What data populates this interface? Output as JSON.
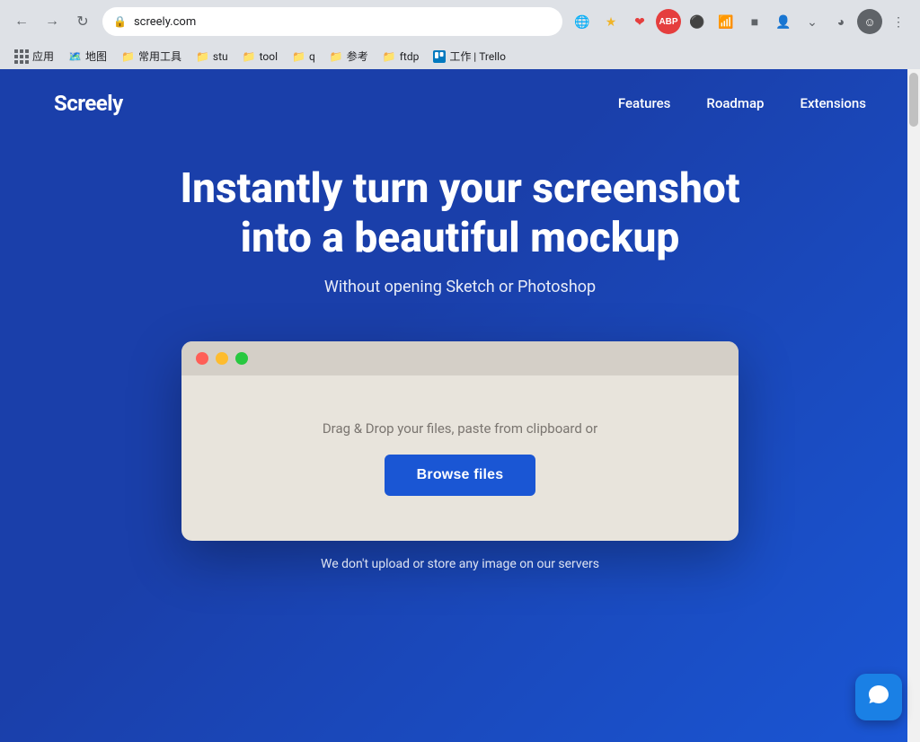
{
  "browser": {
    "url": "screely.com",
    "back_icon": "←",
    "forward_icon": "→",
    "refresh_icon": "↻",
    "lock_icon": "🔒",
    "bookmarks": [
      {
        "label": "应用",
        "icon": "grid"
      },
      {
        "label": "地图",
        "icon": "map"
      },
      {
        "label": "常用工具",
        "icon": "folder"
      },
      {
        "label": "stu",
        "icon": "folder"
      },
      {
        "label": "tool",
        "icon": "folder"
      },
      {
        "label": "q",
        "icon": "folder"
      },
      {
        "label": "参考",
        "icon": "folder"
      },
      {
        "label": "ftdp",
        "icon": "folder"
      },
      {
        "label": "工作 | Trello",
        "icon": "trello"
      }
    ]
  },
  "nav": {
    "logo": "Screely",
    "links": [
      {
        "label": "Features"
      },
      {
        "label": "Roadmap"
      },
      {
        "label": "Extensions"
      }
    ]
  },
  "hero": {
    "title": "Instantly turn your screenshot into a beautiful mockup",
    "subtitle": "Without opening Sketch or Photoshop"
  },
  "upload": {
    "drag_drop_text": "Drag & Drop your files, paste from clipboard or",
    "browse_button_label": "Browse files"
  },
  "footer": {
    "note": "We don't upload or store any image on our servers"
  },
  "chat": {
    "icon": "💬"
  }
}
